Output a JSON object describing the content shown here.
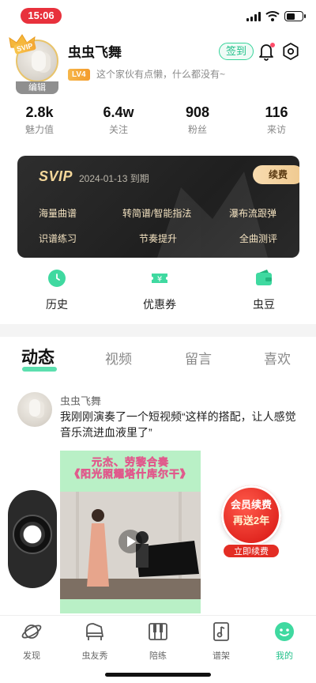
{
  "status_bar": {
    "time": "15:06"
  },
  "profile": {
    "vip_badge": "SVIP",
    "edit_label": "编辑",
    "username": "虫虫飞舞",
    "level": "LV4",
    "bio": "这个家伙有点懒，什么都没有~",
    "signin_label": "签到"
  },
  "stats": [
    {
      "value": "2.8k",
      "label": "魅力值"
    },
    {
      "value": "6.4w",
      "label": "关注"
    },
    {
      "value": "908",
      "label": "粉丝"
    },
    {
      "value": "116",
      "label": "来访"
    }
  ],
  "vip_card": {
    "logo": "SVIP",
    "expiry": "2024-01-13 到期",
    "renew_label": "续费",
    "features": [
      "海量曲谱",
      "转简谱/智能指法",
      "瀑布流跟弹",
      "识谱练习",
      "节奏提升",
      "全曲测评"
    ]
  },
  "quick_actions": [
    {
      "label": "历史",
      "icon": "clock-icon"
    },
    {
      "label": "优惠券",
      "icon": "coupon-icon"
    },
    {
      "label": "虫豆",
      "icon": "wallet-icon"
    }
  ],
  "tabs": [
    "动态",
    "视频",
    "留言",
    "喜欢"
  ],
  "active_tab": "动态",
  "post": {
    "author": "虫虫飞舞",
    "text": "我刚刚演奏了一个短视频“这样的搭配，让人感觉音乐流进血液里了”",
    "video_title_1": "元杰、劳黎合奏",
    "video_title_2": "《阳光照耀塔什库尔干》"
  },
  "promo": {
    "line1": "会员续费",
    "line2": "再送2年",
    "button": "立即续费"
  },
  "bottom_nav": [
    {
      "label": "发现",
      "icon": "planet-icon"
    },
    {
      "label": "虫友秀",
      "icon": "piano-icon"
    },
    {
      "label": "陪练",
      "icon": "keys-icon"
    },
    {
      "label": "谱架",
      "icon": "music-note-icon"
    },
    {
      "label": "我的",
      "icon": "profile-face-icon"
    }
  ],
  "colors": {
    "accent": "#22c08a",
    "vip_gold": "#f3d79a",
    "promo_red": "#e0251f",
    "status_time_bg": "#e8313c"
  }
}
